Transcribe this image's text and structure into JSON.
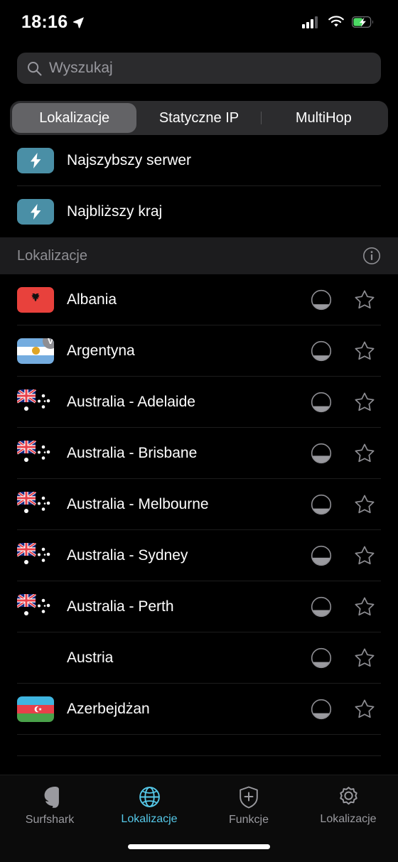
{
  "status_bar": {
    "time": "18:16",
    "location_icon": "location-arrow-icon",
    "signal_icon": "cellular-signal-icon",
    "wifi_icon": "wifi-icon",
    "battery_icon": "battery-charging-icon",
    "battery_color": "#4cd964"
  },
  "search": {
    "placeholder": "Wyszukaj",
    "value": "",
    "icon": "search-icon"
  },
  "segmented_control": {
    "selected": "Lokalizacje",
    "tabs": [
      {
        "label": "Lokalizacje",
        "active": true
      },
      {
        "label": "Statyczne IP",
        "active": false
      },
      {
        "label": "MultiHop",
        "active": false
      }
    ]
  },
  "quick_connect": {
    "items": [
      {
        "label": "Najszybszy serwer",
        "icon": "lightning-bolt-icon"
      },
      {
        "label": "Najbliższy kraj",
        "icon": "lightning-bolt-icon"
      }
    ],
    "tile_color": "#4a8fa6"
  },
  "section_header": {
    "title": "Lokalizacje",
    "info_icon": "info-circle-icon"
  },
  "locations": [
    {
      "name": "Albania",
      "flag": "al",
      "load": 28,
      "favorite": false,
      "badge": null
    },
    {
      "name": "Argentyna",
      "flag": "ar",
      "load": 28,
      "favorite": false,
      "badge": "V"
    },
    {
      "name": "Australia - Adelaide",
      "flag": "au",
      "load": 30,
      "favorite": false,
      "badge": null
    },
    {
      "name": "Australia - Brisbane",
      "flag": "au",
      "load": 38,
      "favorite": false,
      "badge": null
    },
    {
      "name": "Australia - Melbourne",
      "flag": "au",
      "load": 30,
      "favorite": false,
      "badge": null
    },
    {
      "name": "Australia - Sydney",
      "flag": "au",
      "load": 40,
      "favorite": false,
      "badge": null
    },
    {
      "name": "Australia - Perth",
      "flag": "au",
      "load": 34,
      "favorite": false,
      "badge": null
    },
    {
      "name": "Austria",
      "flag": "at",
      "load": 30,
      "favorite": false,
      "badge": null
    },
    {
      "name": "Azerbejdżan",
      "flag": "az",
      "load": 30,
      "favorite": false,
      "badge": null
    },
    {
      "name": "",
      "flag": "be",
      "load": 30,
      "favorite": false,
      "badge": null
    }
  ],
  "tab_bar": {
    "active": "Lokalizacje",
    "active_color": "#55c8e8",
    "inactive_color": "#9a9a9f",
    "items": [
      {
        "label": "Surfshark",
        "icon": "surfshark-logo-icon",
        "active": false
      },
      {
        "label": "Lokalizacje",
        "icon": "globe-icon",
        "active": true
      },
      {
        "label": "Funkcje",
        "icon": "shield-plus-icon",
        "active": false
      },
      {
        "label": "Lokalizacje",
        "icon": "gear-icon",
        "active": false
      }
    ]
  }
}
